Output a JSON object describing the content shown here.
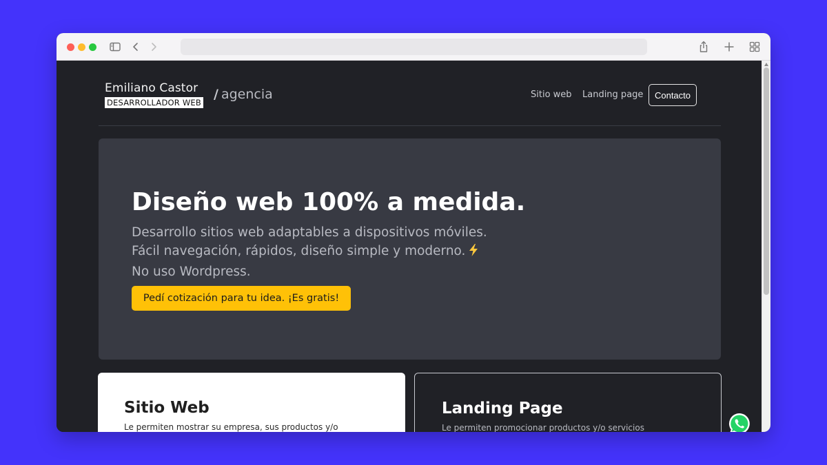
{
  "browser": {
    "address": ""
  },
  "header": {
    "brand_name": "Emiliano Castor",
    "brand_role": "DESARROLLADOR WEB",
    "agency_slash": "/",
    "agency": "agencia",
    "nav": {
      "sitio": "Sitio web",
      "landing": "Landing page",
      "contact": "Contacto"
    }
  },
  "hero": {
    "title": "Diseño web 100% a medida.",
    "line1": "Desarrollo sitios web adaptables a dispositivos móviles.",
    "line2": "Fácil navegación, rápidos, diseño simple y moderno.",
    "line3": "No uso Wordpress.",
    "cta": "Pedí cotización para tu idea. ¡Es gratis!"
  },
  "cards": {
    "sitio": {
      "title": "Sitio Web",
      "desc": "Le permiten mostrar su empresa, sus productos y/o"
    },
    "landing": {
      "title": "Landing Page",
      "desc": "Le permiten promocionar productos y/o servicios"
    }
  },
  "colors": {
    "background": "#4433fb",
    "page": "#202126",
    "hero": "#383a43",
    "accent": "#ffc107",
    "whatsapp": "#25d366"
  },
  "icons": [
    "sidebar-icon",
    "chevron-left-icon",
    "chevron-right-icon",
    "share-icon",
    "plus-icon",
    "tabs-grid-icon",
    "lightning-icon",
    "whatsapp-icon"
  ]
}
